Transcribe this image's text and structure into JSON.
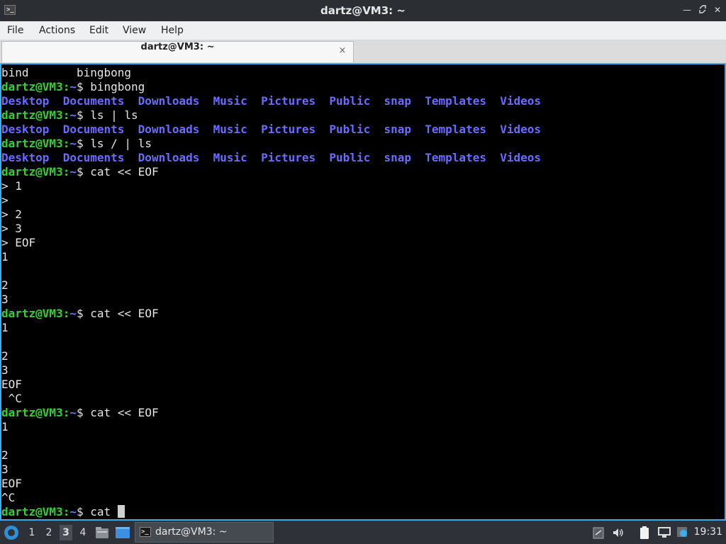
{
  "window": {
    "title": "dartz@VM3: ~",
    "icon": "terminal-icon",
    "controls": [
      "minimize-icon",
      "restore-icon",
      "close-icon"
    ]
  },
  "menu": [
    "File",
    "Actions",
    "Edit",
    "View",
    "Help"
  ],
  "tab": {
    "label": "dartz@VM3: ~",
    "close": "×"
  },
  "terminal": {
    "colors": {
      "background": "#000000",
      "text": "#e5e5e5",
      "user": "#35d035",
      "path": "#5c7cff",
      "directory": "#6b6bff",
      "border": "#3daee9"
    },
    "lines": [
      [
        {
          "t": "bind       bingbong"
        }
      ],
      [
        {
          "t": "dartz@VM3",
          "c": "prompt-user"
        },
        {
          "t": ":",
          "c": "prompt-user"
        },
        {
          "t": "~",
          "c": "prompt-path"
        },
        {
          "t": "$ bingbong"
        }
      ],
      [
        {
          "t": "Desktop",
          "c": "dir"
        },
        {
          "t": "  "
        },
        {
          "t": "Documents",
          "c": "dir"
        },
        {
          "t": "  "
        },
        {
          "t": "Downloads",
          "c": "dir"
        },
        {
          "t": "  "
        },
        {
          "t": "Music",
          "c": "dir"
        },
        {
          "t": "  "
        },
        {
          "t": "Pictures",
          "c": "dir"
        },
        {
          "t": "  "
        },
        {
          "t": "Public",
          "c": "dir"
        },
        {
          "t": "  "
        },
        {
          "t": "snap",
          "c": "dir"
        },
        {
          "t": "  "
        },
        {
          "t": "Templates",
          "c": "dir"
        },
        {
          "t": "  "
        },
        {
          "t": "Videos",
          "c": "dir"
        }
      ],
      [
        {
          "t": "dartz@VM3",
          "c": "prompt-user"
        },
        {
          "t": ":",
          "c": "prompt-user"
        },
        {
          "t": "~",
          "c": "prompt-path"
        },
        {
          "t": "$ ls | ls"
        }
      ],
      [
        {
          "t": "Desktop",
          "c": "dir"
        },
        {
          "t": "  "
        },
        {
          "t": "Documents",
          "c": "dir"
        },
        {
          "t": "  "
        },
        {
          "t": "Downloads",
          "c": "dir"
        },
        {
          "t": "  "
        },
        {
          "t": "Music",
          "c": "dir"
        },
        {
          "t": "  "
        },
        {
          "t": "Pictures",
          "c": "dir"
        },
        {
          "t": "  "
        },
        {
          "t": "Public",
          "c": "dir"
        },
        {
          "t": "  "
        },
        {
          "t": "snap",
          "c": "dir"
        },
        {
          "t": "  "
        },
        {
          "t": "Templates",
          "c": "dir"
        },
        {
          "t": "  "
        },
        {
          "t": "Videos",
          "c": "dir"
        }
      ],
      [
        {
          "t": "dartz@VM3",
          "c": "prompt-user"
        },
        {
          "t": ":",
          "c": "prompt-user"
        },
        {
          "t": "~",
          "c": "prompt-path"
        },
        {
          "t": "$ ls / | ls"
        }
      ],
      [
        {
          "t": "Desktop",
          "c": "dir"
        },
        {
          "t": "  "
        },
        {
          "t": "Documents",
          "c": "dir"
        },
        {
          "t": "  "
        },
        {
          "t": "Downloads",
          "c": "dir"
        },
        {
          "t": "  "
        },
        {
          "t": "Music",
          "c": "dir"
        },
        {
          "t": "  "
        },
        {
          "t": "Pictures",
          "c": "dir"
        },
        {
          "t": "  "
        },
        {
          "t": "Public",
          "c": "dir"
        },
        {
          "t": "  "
        },
        {
          "t": "snap",
          "c": "dir"
        },
        {
          "t": "  "
        },
        {
          "t": "Templates",
          "c": "dir"
        },
        {
          "t": "  "
        },
        {
          "t": "Videos",
          "c": "dir"
        }
      ],
      [
        {
          "t": "dartz@VM3",
          "c": "prompt-user"
        },
        {
          "t": ":",
          "c": "prompt-user"
        },
        {
          "t": "~",
          "c": "prompt-path"
        },
        {
          "t": "$ cat << EOF"
        }
      ],
      [
        {
          "t": "> 1"
        }
      ],
      [
        {
          "t": ">"
        }
      ],
      [
        {
          "t": "> 2"
        }
      ],
      [
        {
          "t": "> 3"
        }
      ],
      [
        {
          "t": "> EOF"
        }
      ],
      [
        {
          "t": "1"
        }
      ],
      [
        {
          "t": ""
        }
      ],
      [
        {
          "t": "2"
        }
      ],
      [
        {
          "t": "3"
        }
      ],
      [
        {
          "t": "dartz@VM3",
          "c": "prompt-user"
        },
        {
          "t": ":",
          "c": "prompt-user"
        },
        {
          "t": "~",
          "c": "prompt-path"
        },
        {
          "t": "$ cat << EOF"
        }
      ],
      [
        {
          "t": "1"
        }
      ],
      [
        {
          "t": ""
        }
      ],
      [
        {
          "t": "2"
        }
      ],
      [
        {
          "t": "3"
        }
      ],
      [
        {
          "t": "EOF"
        }
      ],
      [
        {
          "t": " ^C"
        }
      ],
      [
        {
          "t": "dartz@VM3",
          "c": "prompt-user"
        },
        {
          "t": ":",
          "c": "prompt-user"
        },
        {
          "t": "~",
          "c": "prompt-path"
        },
        {
          "t": "$ cat << EOF"
        }
      ],
      [
        {
          "t": "1"
        }
      ],
      [
        {
          "t": ""
        }
      ],
      [
        {
          "t": "2"
        }
      ],
      [
        {
          "t": "3"
        }
      ],
      [
        {
          "t": "EOF"
        }
      ],
      [
        {
          "t": "^C"
        }
      ],
      [
        {
          "t": "dartz@VM3",
          "c": "prompt-user"
        },
        {
          "t": ":",
          "c": "prompt-user"
        },
        {
          "t": "~",
          "c": "prompt-path"
        },
        {
          "t": "$ cat "
        },
        {
          "t": "",
          "c": "cursor"
        }
      ]
    ]
  },
  "taskbar": {
    "start_icon": "start-menu-icon",
    "workspaces": [
      "1",
      "2",
      "3",
      "4"
    ],
    "active_workspace": "3",
    "launchers": [
      "file-manager-icon",
      "show-desktop-icon"
    ],
    "task": {
      "label": "dartz@VM3: ~",
      "icon": "terminal-icon"
    },
    "tray": [
      "clipboard-icon",
      "volume-icon",
      "power-icon",
      "network-icon",
      "update-icon"
    ],
    "clock": "19:31"
  }
}
